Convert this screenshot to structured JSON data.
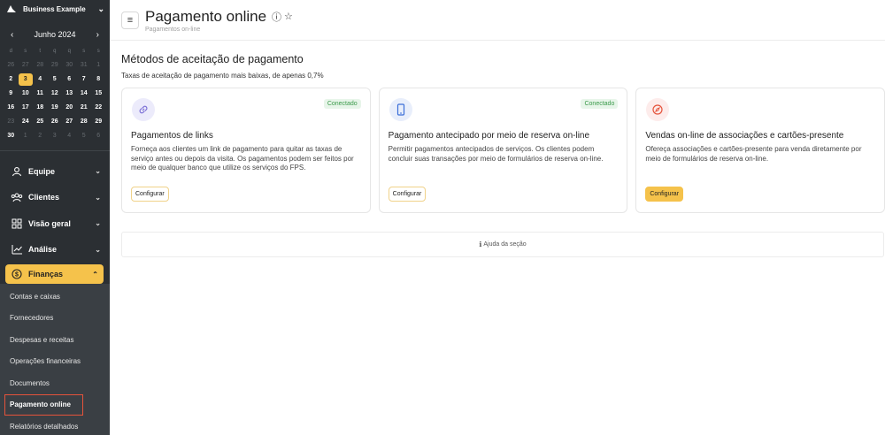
{
  "sidebar": {
    "business_name": "Business Example",
    "calendar": {
      "month": "Junho 2024",
      "weekdays": [
        "d",
        "s",
        "t",
        "q",
        "q",
        "s",
        "s"
      ],
      "weeks": [
        [
          {
            "d": "26",
            "dim": true
          },
          {
            "d": "27",
            "dim": true
          },
          {
            "d": "28",
            "dim": true
          },
          {
            "d": "29",
            "dim": true
          },
          {
            "d": "30",
            "dim": true
          },
          {
            "d": "31",
            "dim": true
          },
          {
            "d": "1",
            "dim": true
          }
        ],
        [
          {
            "d": "2"
          },
          {
            "d": "3",
            "today": true
          },
          {
            "d": "4"
          },
          {
            "d": "5"
          },
          {
            "d": "6"
          },
          {
            "d": "7"
          },
          {
            "d": "8"
          }
        ],
        [
          {
            "d": "9"
          },
          {
            "d": "10"
          },
          {
            "d": "11"
          },
          {
            "d": "12"
          },
          {
            "d": "13"
          },
          {
            "d": "14"
          },
          {
            "d": "15"
          }
        ],
        [
          {
            "d": "16"
          },
          {
            "d": "17"
          },
          {
            "d": "18"
          },
          {
            "d": "19"
          },
          {
            "d": "20"
          },
          {
            "d": "21"
          },
          {
            "d": "22"
          }
        ],
        [
          {
            "d": "23",
            "dim": true
          },
          {
            "d": "24"
          },
          {
            "d": "25"
          },
          {
            "d": "26"
          },
          {
            "d": "27"
          },
          {
            "d": "28"
          },
          {
            "d": "29"
          }
        ],
        [
          {
            "d": "30"
          },
          {
            "d": "1",
            "dim": true
          },
          {
            "d": "2",
            "dim": true
          },
          {
            "d": "3",
            "dim": true
          },
          {
            "d": "4",
            "dim": true
          },
          {
            "d": "5",
            "dim": true
          },
          {
            "d": "6",
            "dim": true
          }
        ]
      ]
    },
    "nav": [
      {
        "label": "Equipe",
        "icon": "person-icon"
      },
      {
        "label": "Clientes",
        "icon": "clients-icon"
      },
      {
        "label": "Visão geral",
        "icon": "overview-icon"
      },
      {
        "label": "Análise",
        "icon": "analytics-icon"
      }
    ],
    "finance": {
      "label": "Finanças",
      "icon": "dollar-icon",
      "items": [
        {
          "label": "Contas e caixas"
        },
        {
          "label": "Fornecedores"
        },
        {
          "label": "Despesas e receitas"
        },
        {
          "label": "Operações financeiras"
        },
        {
          "label": "Documentos"
        },
        {
          "label": "Pagamento online",
          "active": true
        },
        {
          "label": "Relatórios detalhados"
        }
      ]
    }
  },
  "header": {
    "title": "Pagamento online",
    "breadcrumb": "Pagamentos on-line"
  },
  "section": {
    "title": "Métodos de aceitação de pagamento",
    "description": "Taxas de aceitação de pagamento mais baixas, de apenas 0,7%"
  },
  "cards": [
    {
      "icon": "link-icon",
      "icon_color": "#7b6fd6",
      "icon_bg": "#ecebfb",
      "badge": "Conectado",
      "title": "Pagamentos de links",
      "description": "Forneça aos clientes um link de pagamento para quitar as taxas de serviço antes ou depois da visita. Os pagamentos podem ser feitos por meio de qualquer banco que utilize os serviços do FPS.",
      "button": "Configurar",
      "primary": false
    },
    {
      "icon": "phone-icon",
      "icon_color": "#3b6fd8",
      "icon_bg": "#e8eefb",
      "badge": "Conectado",
      "title": "Pagamento antecipado por meio de reserva on-line",
      "description": "Permitir pagamentos antecipados de serviços. Os clientes podem concluir suas transações por meio de formulários de reserva on-line.",
      "button": "Configurar",
      "primary": false
    },
    {
      "icon": "compass-icon",
      "icon_color": "#e5533b",
      "icon_bg": "#fdeceb",
      "badge": "",
      "title": "Vendas on-line de associações e cartões-presente",
      "description": "Ofereça associações e cartões-presente para venda diretamente por meio de formulários de reserva on-line.",
      "button": "Configurar",
      "primary": true
    }
  ],
  "help": {
    "label": "Ajuda da seção",
    "icon": "info-icon"
  }
}
